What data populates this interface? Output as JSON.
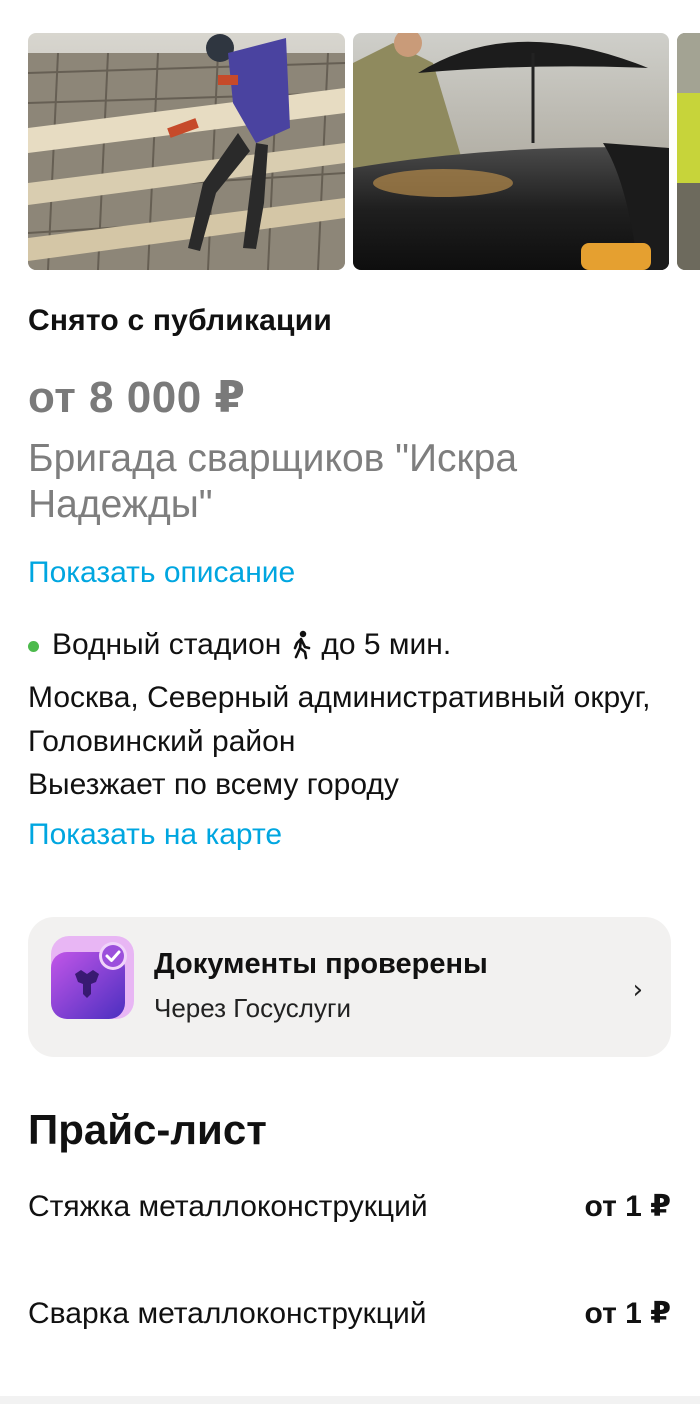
{
  "gallery": {
    "photos": [
      {
        "icon": "photo-welder-on-rebar"
      },
      {
        "icon": "photo-welders-with-umbrella-on-pipe"
      },
      {
        "icon": "photo-partial-next"
      }
    ]
  },
  "listing": {
    "status": "Снято с публикации",
    "price": "от 8 000 ₽",
    "title": "Бригада сварщиков \"Искра Надежды\"",
    "show_description": "Показать описание"
  },
  "location": {
    "metro_station": "Водный стадион",
    "metro_color": "#4cba4c",
    "walk_icon": "walking-person-icon",
    "walk_time": "до 5 мин.",
    "address": "Москва, Северный административный округ, Головинский район",
    "travels": "Выезжает по всему городу",
    "show_map": "Показать на карте"
  },
  "verification": {
    "icon": "gosuslugi-verified-icon",
    "title": "Документы проверены",
    "subtitle": "Через Госуслуги",
    "chevron": "›"
  },
  "price_list": {
    "heading": "Прайс-лист",
    "items": [
      {
        "name": "Стяжка металлоконструкций",
        "price": "от 1 ₽"
      },
      {
        "name": "Сварка металлоконструкций",
        "price": "от 1 ₽"
      }
    ]
  },
  "colors": {
    "link": "#00a6e0",
    "price_grey": "#7a7a7a",
    "card_bg": "#f2f1f0",
    "verify_purple": "#6f3fd0"
  }
}
